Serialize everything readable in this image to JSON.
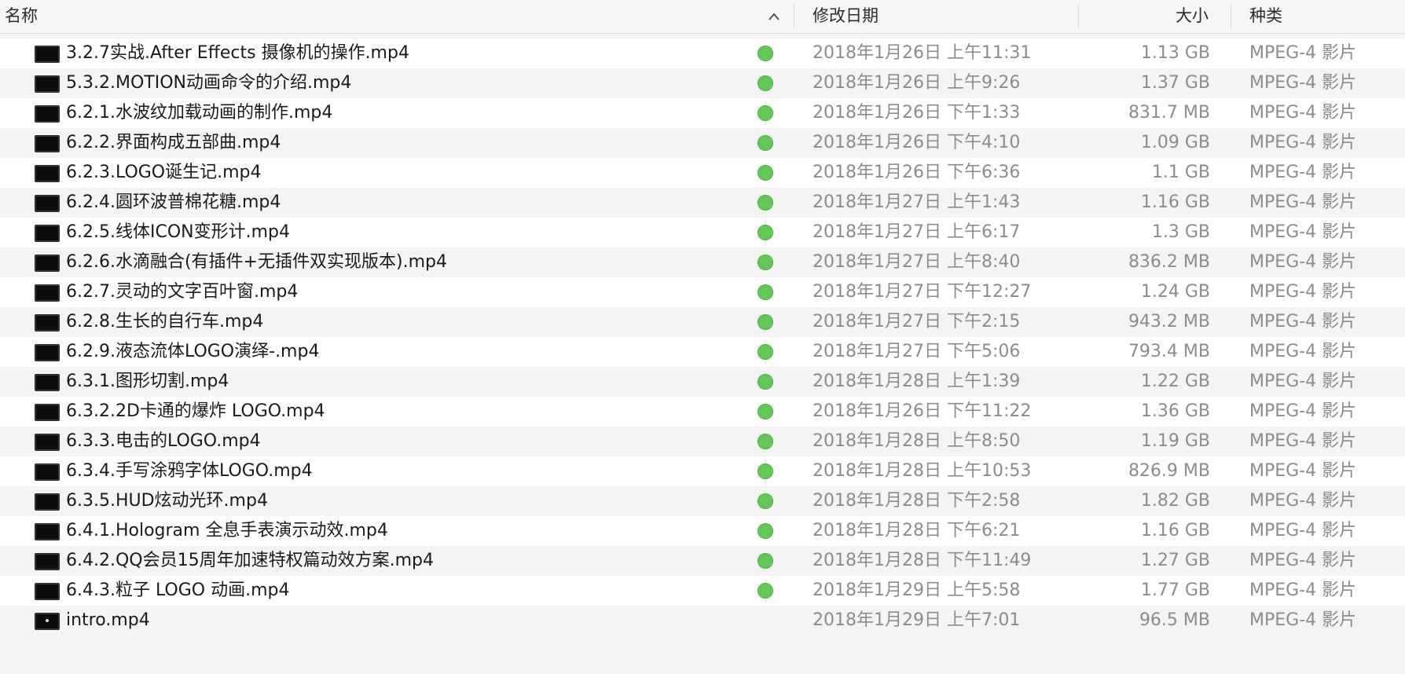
{
  "header": {
    "name": "名称",
    "date": "修改日期",
    "size": "大小",
    "kind": "种类",
    "sort_icon": "chevron-up-icon"
  },
  "colors": {
    "tag_green": "#62c956",
    "secondary_text": "#8c8c8c",
    "row_alt": "#f4f4f4"
  },
  "files": [
    {
      "name": "3.2.7实战.After Effects 摄像机的操作.mp4",
      "date": "2018年1月26日 上午11:31",
      "size": "1.13 GB",
      "kind": "MPEG-4 影片",
      "tag": "green",
      "icon": "video-file-icon"
    },
    {
      "name": "5.3.2.MOTION动画命令的介绍.mp4",
      "date": "2018年1月26日 上午9:26",
      "size": "1.37 GB",
      "kind": "MPEG-4 影片",
      "tag": "green",
      "icon": "video-file-icon"
    },
    {
      "name": "6.2.1.水波纹加载动画的制作.mp4",
      "date": "2018年1月26日 下午1:33",
      "size": "831.7 MB",
      "kind": "MPEG-4 影片",
      "tag": "green",
      "icon": "video-file-icon"
    },
    {
      "name": "6.2.2.界面构成五部曲.mp4",
      "date": "2018年1月26日 下午4:10",
      "size": "1.09 GB",
      "kind": "MPEG-4 影片",
      "tag": "green",
      "icon": "video-file-icon"
    },
    {
      "name": "6.2.3.LOGO诞生记.mp4",
      "date": "2018年1月26日 下午6:36",
      "size": "1.1 GB",
      "kind": "MPEG-4 影片",
      "tag": "green",
      "icon": "video-file-icon"
    },
    {
      "name": "6.2.4.圆环波普棉花糖.mp4",
      "date": "2018年1月27日 上午1:43",
      "size": "1.16 GB",
      "kind": "MPEG-4 影片",
      "tag": "green",
      "icon": "video-file-icon"
    },
    {
      "name": "6.2.5.线体ICON变形计.mp4",
      "date": "2018年1月27日 上午6:17",
      "size": "1.3 GB",
      "kind": "MPEG-4 影片",
      "tag": "green",
      "icon": "video-file-icon"
    },
    {
      "name": "6.2.6.水滴融合(有插件+无插件双实现版本).mp4",
      "date": "2018年1月27日 上午8:40",
      "size": "836.2 MB",
      "kind": "MPEG-4 影片",
      "tag": "green",
      "icon": "video-file-icon"
    },
    {
      "name": "6.2.7.灵动的文字百叶窗.mp4",
      "date": "2018年1月27日 下午12:27",
      "size": "1.24 GB",
      "kind": "MPEG-4 影片",
      "tag": "green",
      "icon": "video-file-icon"
    },
    {
      "name": "6.2.8.生长的自行车.mp4",
      "date": "2018年1月27日 下午2:15",
      "size": "943.2 MB",
      "kind": "MPEG-4 影片",
      "tag": "green",
      "icon": "video-file-icon"
    },
    {
      "name": "6.2.9.液态流体LOGO演绎-.mp4",
      "date": "2018年1月27日 下午5:06",
      "size": "793.4 MB",
      "kind": "MPEG-4 影片",
      "tag": "green",
      "icon": "video-file-icon"
    },
    {
      "name": "6.3.1.图形切割.mp4",
      "date": "2018年1月28日 上午1:39",
      "size": "1.22 GB",
      "kind": "MPEG-4 影片",
      "tag": "green",
      "icon": "video-file-icon"
    },
    {
      "name": "6.3.2.2D卡通的爆炸 LOGO.mp4",
      "date": "2018年1月26日 下午11:22",
      "size": "1.36 GB",
      "kind": "MPEG-4 影片",
      "tag": "green",
      "icon": "video-file-icon"
    },
    {
      "name": "6.3.3.电击的LOGO.mp4",
      "date": "2018年1月28日 上午8:50",
      "size": "1.19 GB",
      "kind": "MPEG-4 影片",
      "tag": "green",
      "icon": "video-file-icon"
    },
    {
      "name": "6.3.4.手写涂鸦字体LOGO.mp4",
      "date": "2018年1月28日 上午10:53",
      "size": "826.9 MB",
      "kind": "MPEG-4 影片",
      "tag": "green",
      "icon": "video-file-icon"
    },
    {
      "name": "6.3.5.HUD炫动光环.mp4",
      "date": "2018年1月28日 下午2:58",
      "size": "1.82 GB",
      "kind": "MPEG-4 影片",
      "tag": "green",
      "icon": "video-file-icon"
    },
    {
      "name": "6.4.1.Hologram 全息手表演示动效.mp4",
      "date": "2018年1月28日 下午6:21",
      "size": "1.16 GB",
      "kind": "MPEG-4 影片",
      "tag": "green",
      "icon": "video-file-icon"
    },
    {
      "name": "6.4.2.QQ会员15周年加速特权篇动效方案.mp4",
      "date": "2018年1月28日 下午11:49",
      "size": "1.27 GB",
      "kind": "MPEG-4 影片",
      "tag": "green",
      "icon": "video-file-icon"
    },
    {
      "name": "6.4.3.粒子 LOGO 动画.mp4",
      "date": "2018年1月29日 上午5:58",
      "size": "1.77 GB",
      "kind": "MPEG-4 影片",
      "tag": "green",
      "icon": "video-file-icon"
    },
    {
      "name": "intro.mp4",
      "date": "2018年1月29日 上午7:01",
      "size": "96.5 MB",
      "kind": "MPEG-4 影片",
      "tag": "",
      "icon": "video-file-icon"
    }
  ]
}
